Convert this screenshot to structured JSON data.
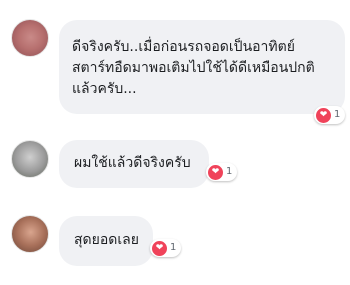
{
  "comments": [
    {
      "lines": [
        "ดีจริงครับ..เมื่อก่อนรถจอดเป็นอาทิตย์",
        "สตาร์ทอืดมาพอเติมไปใช้ได้ดีเหมือนปกติ",
        "แล้วครับ..."
      ],
      "reaction": {
        "icon": "heart-icon",
        "count": "1"
      }
    },
    {
      "lines": [
        "ผมใช้แล้วดีจริงครับ"
      ],
      "reaction": {
        "icon": "heart-icon",
        "count": "1"
      }
    },
    {
      "lines": [
        "สุดยอดเลย"
      ],
      "reaction": {
        "icon": "heart-icon",
        "count": "1"
      }
    }
  ],
  "colors": {
    "bubble": "#f0f1f4",
    "heart": "#f0435a",
    "text": "#1c1e21",
    "count": "#606770"
  }
}
